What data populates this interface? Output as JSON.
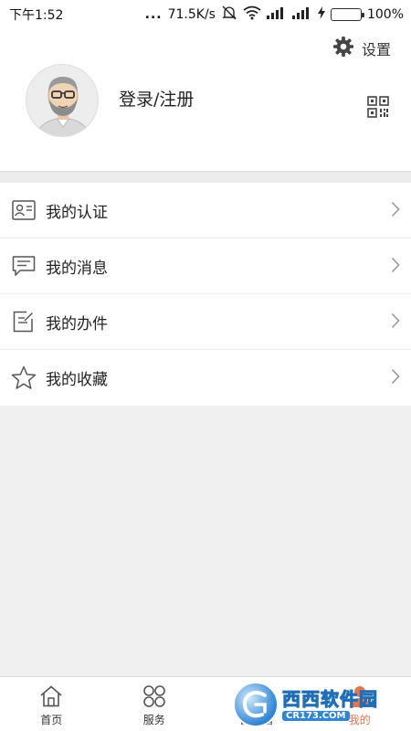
{
  "status_bar": {
    "time": "下午1:52",
    "dots": "...",
    "speed": "71.5K/s",
    "battery": "100%"
  },
  "profile": {
    "settings_label": "设置",
    "login_label": "登录/注册"
  },
  "menu": {
    "items": [
      {
        "label": "我的认证",
        "icon": "id-card-icon"
      },
      {
        "label": "我的消息",
        "icon": "message-icon"
      },
      {
        "label": "我的办件",
        "icon": "document-icon"
      },
      {
        "label": "我的收藏",
        "icon": "star-icon"
      }
    ]
  },
  "bottom_nav": {
    "items": [
      {
        "label": "首页",
        "icon": "home-icon"
      },
      {
        "label": "服务",
        "icon": "grid-icon"
      },
      {
        "label": "品牌谱",
        "icon": "brand-icon"
      },
      {
        "label": "我的",
        "icon": "person-icon"
      }
    ],
    "active_index": 3,
    "active_color": "#e8754a"
  },
  "watermark": {
    "main": "西西软件园",
    "sub": "CR173.COM"
  }
}
